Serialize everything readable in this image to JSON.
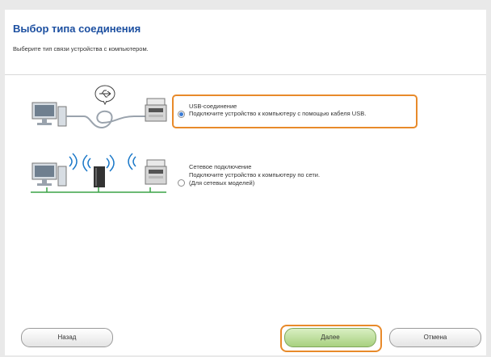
{
  "dialog": {
    "title": "Выбор типа соединения",
    "subtitle": "Выберите тип связи устройства с компьютером."
  },
  "options": [
    {
      "id": "usb",
      "title": "USB-соединение",
      "desc": "Подключите устройство к компьютеру с помощью кабеля USB.",
      "selected": true
    },
    {
      "id": "network",
      "title": "Сетевое подключение",
      "desc": "Подключите устройство к компьютеру по сети.",
      "note": "(Для сетевых моделей)",
      "selected": false
    }
  ],
  "buttons": {
    "back": "Назад",
    "next": "Далее",
    "cancel": "Отмена"
  },
  "colors": {
    "accent": "#e88a2a",
    "title": "#1c4fa0",
    "next_button": "#a8d17f",
    "network_waves": "#1a78c8",
    "cable_line": "#3aa347"
  },
  "icons": [
    "computer-icon",
    "usb-symbol-icon",
    "usb-cable-icon",
    "printer-icon",
    "wireless-router-icon",
    "network-line-icon"
  ]
}
